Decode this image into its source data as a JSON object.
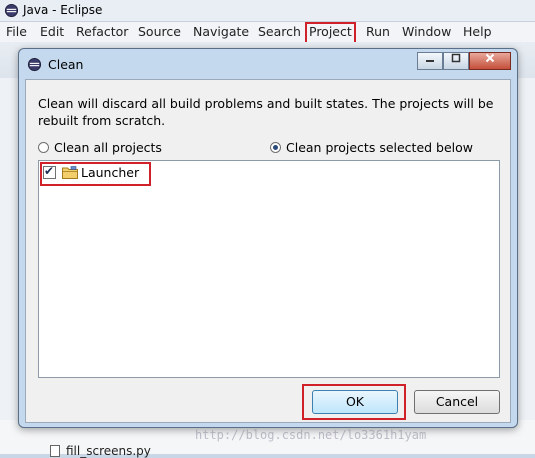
{
  "window": {
    "title": "Java - Eclipse"
  },
  "menubar": {
    "items": [
      {
        "label": "File"
      },
      {
        "label": "Edit"
      },
      {
        "label": "Refactor"
      },
      {
        "label": "Source"
      },
      {
        "label": "Navigate"
      },
      {
        "label": "Search"
      },
      {
        "label": "Project"
      },
      {
        "label": "Run"
      },
      {
        "label": "Window"
      },
      {
        "label": "Help"
      }
    ]
  },
  "dialog": {
    "title": "Clean",
    "description": "Clean will discard all build problems and built states.  The projects will be rebuilt from scratch.",
    "options": {
      "clean_all": "Clean all projects",
      "clean_selected": "Clean projects selected below",
      "selected": "clean_selected"
    },
    "projects": [
      {
        "name": "Launcher",
        "checked": true
      }
    ],
    "buttons": {
      "ok": "OK",
      "cancel": "Cancel"
    }
  },
  "background": {
    "file_item": "fill_screens.py"
  },
  "watermark": "http://blog.csdn.net/lo3361h1yam",
  "colors": {
    "highlight": "#d0202a",
    "dialog_frame": "#c5d9ee",
    "default_button": "#bee6fd"
  },
  "icons": [
    "eclipse-icon",
    "folder-project-icon",
    "checkmark-icon",
    "python-file-icon"
  ]
}
